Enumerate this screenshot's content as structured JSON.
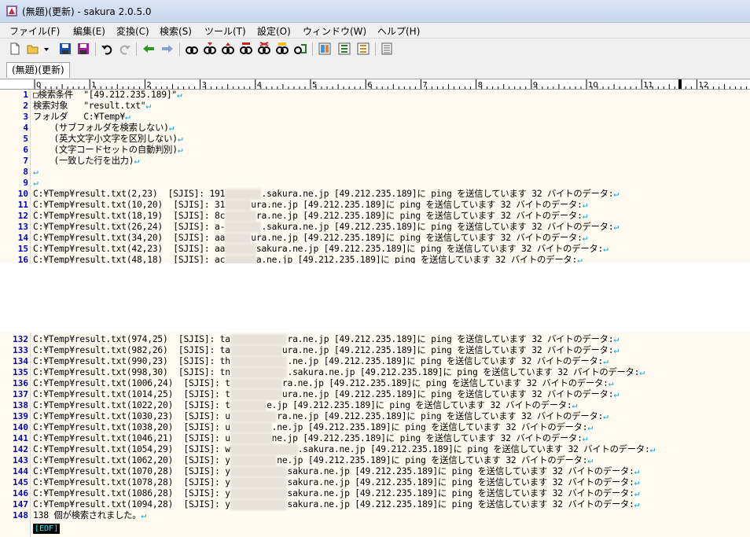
{
  "window": {
    "title": "(無題)(更新) - sakura 2.0.5.0"
  },
  "menu": [
    "ファイル(F)",
    "編集(E)",
    "変換(C)",
    "検索(S)",
    "ツール(T)",
    "設定(O)",
    "ウィンドウ(W)",
    "ヘルプ(H)"
  ],
  "toolbar": {
    "icons": [
      "new-file-icon",
      "open-folder-icon",
      "dropdown-arrow-icon",
      "save-icon",
      "save-all-icon",
      "undo-icon",
      "redo-icon",
      "jump-back-icon",
      "jump-forward-icon",
      "search-icon",
      "search-next-icon",
      "search-prev-icon",
      "replace-icon",
      "grep-icon",
      "grep-replace-icon",
      "outline-icon",
      "compare-icon",
      "tag-jump-icon",
      "settings-icon"
    ]
  },
  "tabs": [
    {
      "label": "(無題)(更新)"
    }
  ],
  "ruler": {
    "labels": [
      "0",
      "1",
      "2",
      "3",
      "4",
      "5",
      "6",
      "7",
      "8",
      "9",
      "10",
      "11",
      "12"
    ]
  },
  "colors": {
    "line_number": "#0000c0",
    "newline_mark": "#00a0e0",
    "editor_bg": "#fffbf0",
    "eof_bg": "#000000",
    "eof_fg": "#00ffff"
  },
  "editor": {
    "upper_lines": [
      {
        "n": "1",
        "text": "□検索条件  \"[49.212.235.189]\""
      },
      {
        "n": "2",
        "text": "検索対象   \"result.txt\""
      },
      {
        "n": "3",
        "text": "フォルダ   C:¥Temp¥"
      },
      {
        "n": "4",
        "text": "    (サブフォルダを検索しない)"
      },
      {
        "n": "5",
        "text": "    (英大文字小文字を区別しない)"
      },
      {
        "n": "6",
        "text": "    (文字コードセットの自動判別)"
      },
      {
        "n": "7",
        "text": "    (一致した行を出力)"
      },
      {
        "n": "8",
        "text": ""
      },
      {
        "n": "9",
        "text": ""
      },
      {
        "n": "10",
        "text": "C:¥Temp¥result.txt(2,23)  [SJIS]: 191",
        "blur": "xxxxxxx",
        "rest": ".sakura.ne.jp [49.212.235.189]に ping を送信しています 32 バイトのデータ:"
      },
      {
        "n": "11",
        "text": "C:¥Temp¥result.txt(10,20)  [SJIS]: 31",
        "blur": "xxxxx",
        "rest": "ura.ne.jp [49.212.235.189]に ping を送信しています 32 バイトのデータ:"
      },
      {
        "n": "12",
        "text": "C:¥Temp¥result.txt(18,19)  [SJIS]: 8c",
        "blur": "xxxxxx",
        "rest": "ra.ne.jp [49.212.235.189]に ping を送信しています 32 バイトのデータ:"
      },
      {
        "n": "13",
        "text": "C:¥Temp¥result.txt(26,24)  [SJIS]: a-",
        "blur": "xxxxxxx",
        "rest": ".sakura.ne.jp [49.212.235.189]に ping を送信しています 32 バイトのデータ:"
      },
      {
        "n": "14",
        "text": "C:¥Temp¥result.txt(34,20)  [SJIS]: aa",
        "blur": "xxxxx",
        "rest": "ura.ne.jp [49.212.235.189]に ping を送信しています 32 バイトのデータ:"
      },
      {
        "n": "15",
        "text": "C:¥Temp¥result.txt(42,23)  [SJIS]: aa",
        "blur": "xxxxxx",
        "rest": "sakura.ne.jp [49.212.235.189]に ping を送信しています 32 バイトのデータ:"
      },
      {
        "n": "16",
        "text": "C:¥Temp¥result.txt(48,18)  [SJIS]: ac",
        "blur": "xxxxxx",
        "rest": "a.ne.jp [49.212.235.189]に ping を送信しています 32 バイトのデータ:"
      }
    ],
    "lower_lines": [
      {
        "n": "132",
        "text": "C:¥Temp¥result.txt(974,25)  [SJIS]: ta",
        "blur": "xxxxxxxxxxx",
        "rest": "ra.ne.jp [49.212.235.189]に ping を送信しています 32 バイトのデータ:"
      },
      {
        "n": "133",
        "text": "C:¥Temp¥result.txt(982,26)  [SJIS]: ta",
        "blur": "xxxxxxxxxx",
        "rest": "ura.ne.jp [49.212.235.189]に ping を送信しています 32 バイトのデータ:"
      },
      {
        "n": "134",
        "text": "C:¥Temp¥result.txt(990,23)  [SJIS]: th",
        "blur": "xxxxxxxxxxx",
        "rest": ".ne.jp [49.212.235.189]に ping を送信しています 32 バイトのデータ:"
      },
      {
        "n": "135",
        "text": "C:¥Temp¥result.txt(998,30)  [SJIS]: tn",
        "blur": "xxxxxxxxxxx",
        "rest": ".sakura.ne.jp [49.212.235.189]に ping を送信しています 32 バイトのデータ:"
      },
      {
        "n": "136",
        "text": "C:¥Temp¥result.txt(1006,24)  [SJIS]: t",
        "blur": "xxxxxxxxxx",
        "rest": "ra.ne.jp [49.212.235.189]に ping を送信しています 32 バイトのデータ:"
      },
      {
        "n": "137",
        "text": "C:¥Temp¥result.txt(1014,25)  [SJIS]: t",
        "blur": "xxxxxxxxxx",
        "rest": "ura.ne.jp [49.212.235.189]に ping を送信しています 32 バイトのデータ:"
      },
      {
        "n": "138",
        "text": "C:¥Temp¥result.txt(1022,20)  [SJIS]: t",
        "blur": "xxxxxxx",
        "rest": "e.jp [49.212.235.189]に ping を送信しています 32 バイトのデータ:"
      },
      {
        "n": "139",
        "text": "C:¥Temp¥result.txt(1030,23)  [SJIS]: u",
        "blur": "xxxxxxxxx",
        "rest": "ra.ne.jp [49.212.235.189]に ping を送信しています 32 バイトのデータ:"
      },
      {
        "n": "140",
        "text": "C:¥Temp¥result.txt(1038,20)  [SJIS]: u",
        "blur": "xxxxxxxx",
        "rest": ".ne.jp [49.212.235.189]に ping を送信しています 32 バイトのデータ:"
      },
      {
        "n": "141",
        "text": "C:¥Temp¥result.txt(1046,21)  [SJIS]: u",
        "blur": "xxxxxxxx",
        "rest": "ne.jp [49.212.235.189]に ping を送信しています 32 バイトのデータ:"
      },
      {
        "n": "142",
        "text": "C:¥Temp¥result.txt(1054,29)  [SJIS]: w",
        "blur": "xxxxxxxxxxxxx",
        "rest": ".sakura.ne.jp [49.212.235.189]に ping を送信しています 32 バイトのデータ:"
      },
      {
        "n": "143",
        "text": "C:¥Temp¥result.txt(1062,20)  [SJIS]: y",
        "blur": "xxxxxxxxx",
        "rest": "ne.jp [49.212.235.189]に ping を送信しています 32 バイトのデータ:"
      },
      {
        "n": "144",
        "text": "C:¥Temp¥result.txt(1070,28)  [SJIS]: y",
        "blur": "xxxxxxxxxxx",
        "rest": "sakura.ne.jp [49.212.235.189]に ping を送信しています 32 バイトのデータ:"
      },
      {
        "n": "145",
        "text": "C:¥Temp¥result.txt(1078,28)  [SJIS]: y",
        "blur": "xxxxxxxxxxx",
        "rest": "sakura.ne.jp [49.212.235.189]に ping を送信しています 32 バイトのデータ:"
      },
      {
        "n": "146",
        "text": "C:¥Temp¥result.txt(1086,28)  [SJIS]: y",
        "blur": "xxxxxxxxxxx",
        "rest": "sakura.ne.jp [49.212.235.189]に ping を送信しています 32 バイトのデータ:"
      },
      {
        "n": "147",
        "text": "C:¥Temp¥result.txt(1094,28)  [SJIS]: y",
        "blur": "xxxxxxxxxxx",
        "rest": "sakura.ne.jp [49.212.235.189]に ping を送信しています 32 バイトのデータ:"
      },
      {
        "n": "148",
        "text": "138 個が検索されました。"
      }
    ],
    "eof_label": "[EOF]"
  }
}
